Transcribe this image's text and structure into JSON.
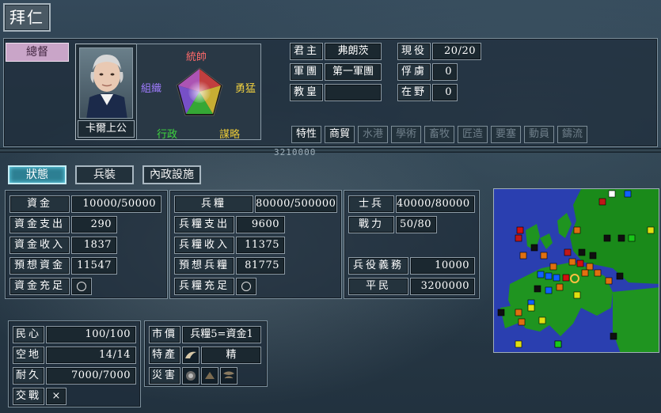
{
  "window": {
    "title": "拜仁"
  },
  "governor": {
    "rank": "總督",
    "portrait_name": "卡爾上公",
    "stats": {
      "top": "統帥",
      "right": "勇猛",
      "left": "組織",
      "bottom_left": "行政",
      "bottom_right": "謀略"
    },
    "stat_colors": {
      "top": "#ff5a5a",
      "right": "#f2d43c",
      "left": "#9b6cff",
      "bottom_left": "#3fd13f",
      "bottom_right": "#e0c030"
    }
  },
  "info": {
    "monarch_label": "君主",
    "monarch_value": "弗朗茨",
    "army_label": "軍團",
    "army_value": "第一軍團",
    "pope_label": "教皇",
    "pope_value": "",
    "active_label": "現役",
    "active_value": "20/20",
    "captive_label": "俘虜",
    "captive_value": "0",
    "wild_label": "在野",
    "wild_value": "0"
  },
  "traits": [
    {
      "label": "特性",
      "active": true
    },
    {
      "label": "商貿",
      "active": true
    },
    {
      "label": "水港",
      "active": false
    },
    {
      "label": "學術",
      "active": false
    },
    {
      "label": "畜牧",
      "active": false
    },
    {
      "label": "匠造",
      "active": false
    },
    {
      "label": "要塞",
      "active": false
    },
    {
      "label": "動員",
      "active": false
    },
    {
      "label": "鑄流",
      "active": false
    }
  ],
  "divider_text": "3210000",
  "tabs": [
    {
      "label": "狀態",
      "active": true
    },
    {
      "label": "兵裝",
      "active": false
    },
    {
      "label": "內政設施",
      "active": false
    }
  ],
  "funds": {
    "funds_label": "資金",
    "funds_value": "10000/50000",
    "expense_label": "資金支出",
    "expense_value": "290",
    "income_label": "資金收入",
    "income_value": "1837",
    "forecast_label": "預想資金",
    "forecast_value": "11547",
    "sufficient_label": "資金充足"
  },
  "food": {
    "food_label": "兵糧",
    "food_value": "80000/500000",
    "expense_label": "兵糧支出",
    "expense_value": "9600",
    "income_label": "兵糧收入",
    "income_value": "11375",
    "forecast_label": "預想兵糧",
    "forecast_value": "81775",
    "sufficient_label": "兵糧充足"
  },
  "military": {
    "soldiers_label": "士兵",
    "soldiers_value": "40000/80000",
    "power_label": "戰力",
    "power_value": "50/80",
    "duty_label": "兵役義務",
    "duty_value": "10000",
    "civilians_label": "平民",
    "civilians_value": "3200000"
  },
  "city": {
    "loyalty_label": "民心",
    "loyalty_value": "100/100",
    "land_label": "空地",
    "land_value": "14/14",
    "durability_label": "耐久",
    "durability_value": "7000/7000",
    "war_label": "交戰",
    "war_value": "×"
  },
  "market": {
    "price_label": "市價",
    "price_value": "兵糧5=資金1",
    "special_label": "特產",
    "special_value": "精",
    "disaster_label": "災害"
  },
  "icons": {
    "special_icon": "horn-icon",
    "disaster_icons": [
      "plague-icon",
      "locust-icon",
      "storm-icon"
    ]
  }
}
